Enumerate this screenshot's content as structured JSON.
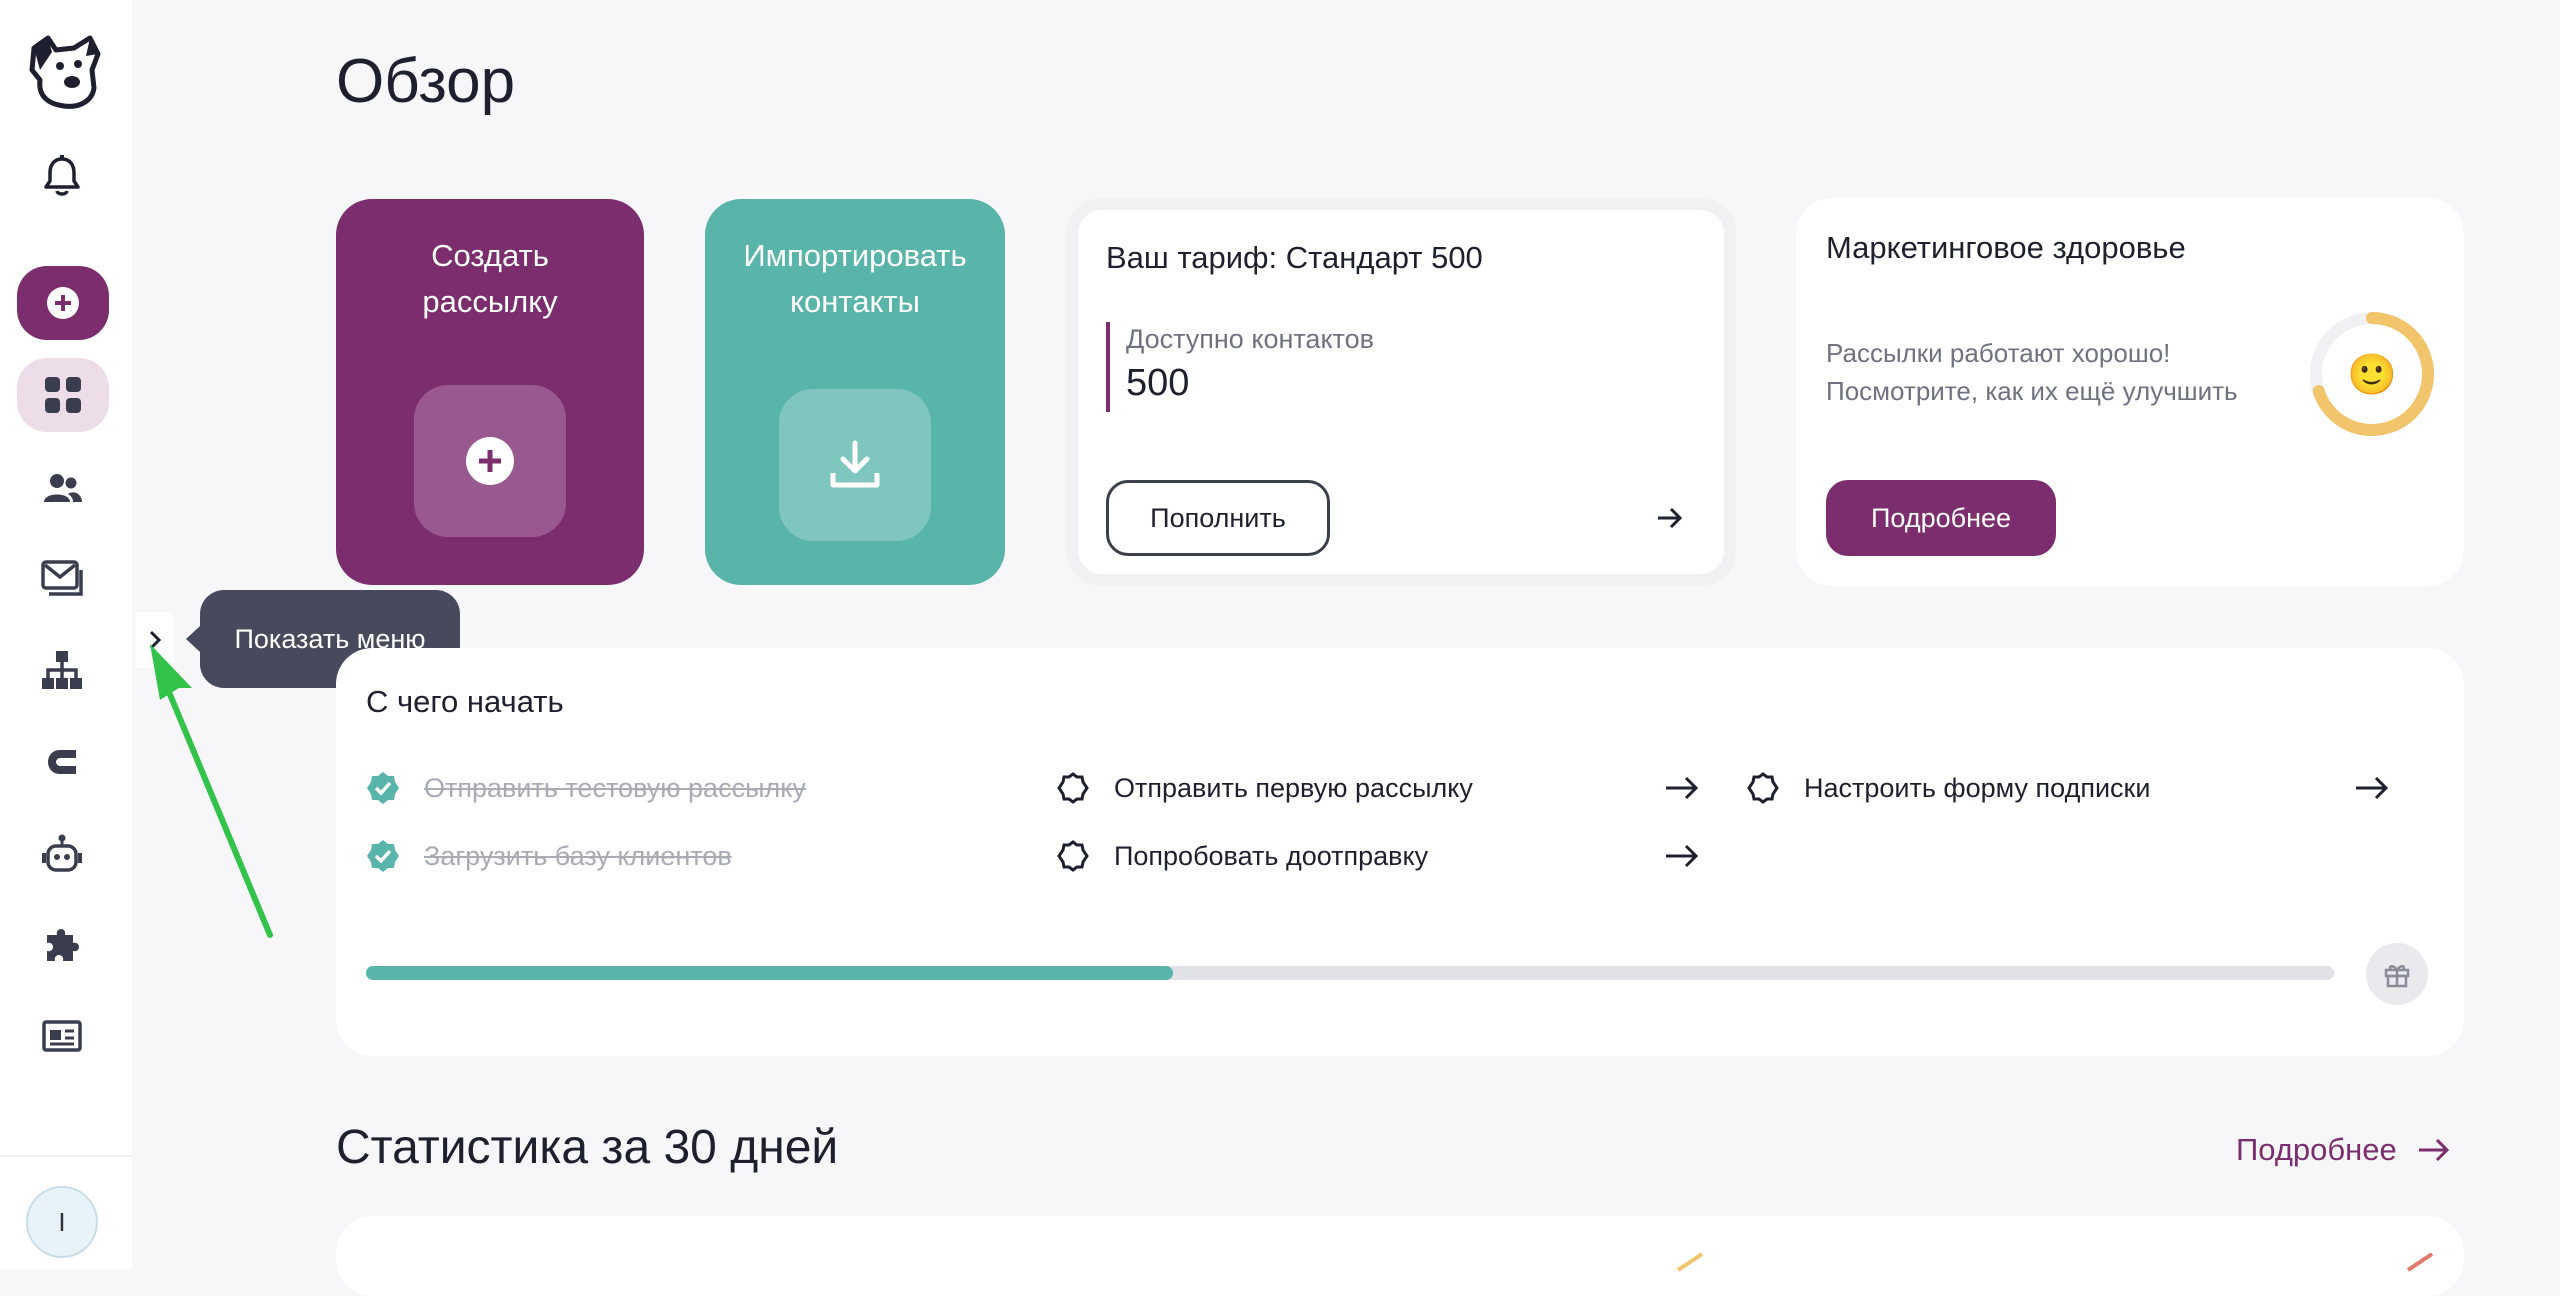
{
  "sidebar": {
    "avatar_initial": "I",
    "tooltip": "Показать меню",
    "items": [
      {
        "name": "bell-icon"
      },
      {
        "name": "create-icon"
      },
      {
        "name": "dashboard-icon"
      },
      {
        "name": "contacts-icon"
      },
      {
        "name": "mail-icon"
      },
      {
        "name": "sitemap-icon"
      },
      {
        "name": "magnet-icon"
      },
      {
        "name": "bot-icon"
      },
      {
        "name": "puzzle-icon"
      },
      {
        "name": "news-icon"
      }
    ]
  },
  "page": {
    "title": "Обзор"
  },
  "tiles": {
    "create_title": "Создать рассылку",
    "import_title": "Импортировать контакты"
  },
  "tariff": {
    "title": "Ваш тариф: Стандарт 500",
    "label": "Доступно контактов",
    "value": "500",
    "topup": "Пополнить"
  },
  "health": {
    "title": "Маркетинговое здоровье",
    "text": "Рассылки работают хорошо! Посмотрите, как их ещё улучшить",
    "more": "Подробнее",
    "emoji": "🙂",
    "score": 0.7
  },
  "start": {
    "title": "С чего начать",
    "tasks": [
      {
        "label": "Отправить тестовую рассылку",
        "done": true
      },
      {
        "label": "Загрузить базу клиентов",
        "done": true
      },
      {
        "label": "Отправить первую рассылку",
        "done": false
      },
      {
        "label": "Попробовать доотправку",
        "done": false
      },
      {
        "label": "Настроить форму подписки",
        "done": false
      }
    ],
    "progress": 0.41
  },
  "stats": {
    "title": "Статистика за 30 дней",
    "more": "Подробнее"
  },
  "colors": {
    "brand": "#7b2d6e",
    "teal": "#59b4aa",
    "dark": "#1e2030"
  }
}
